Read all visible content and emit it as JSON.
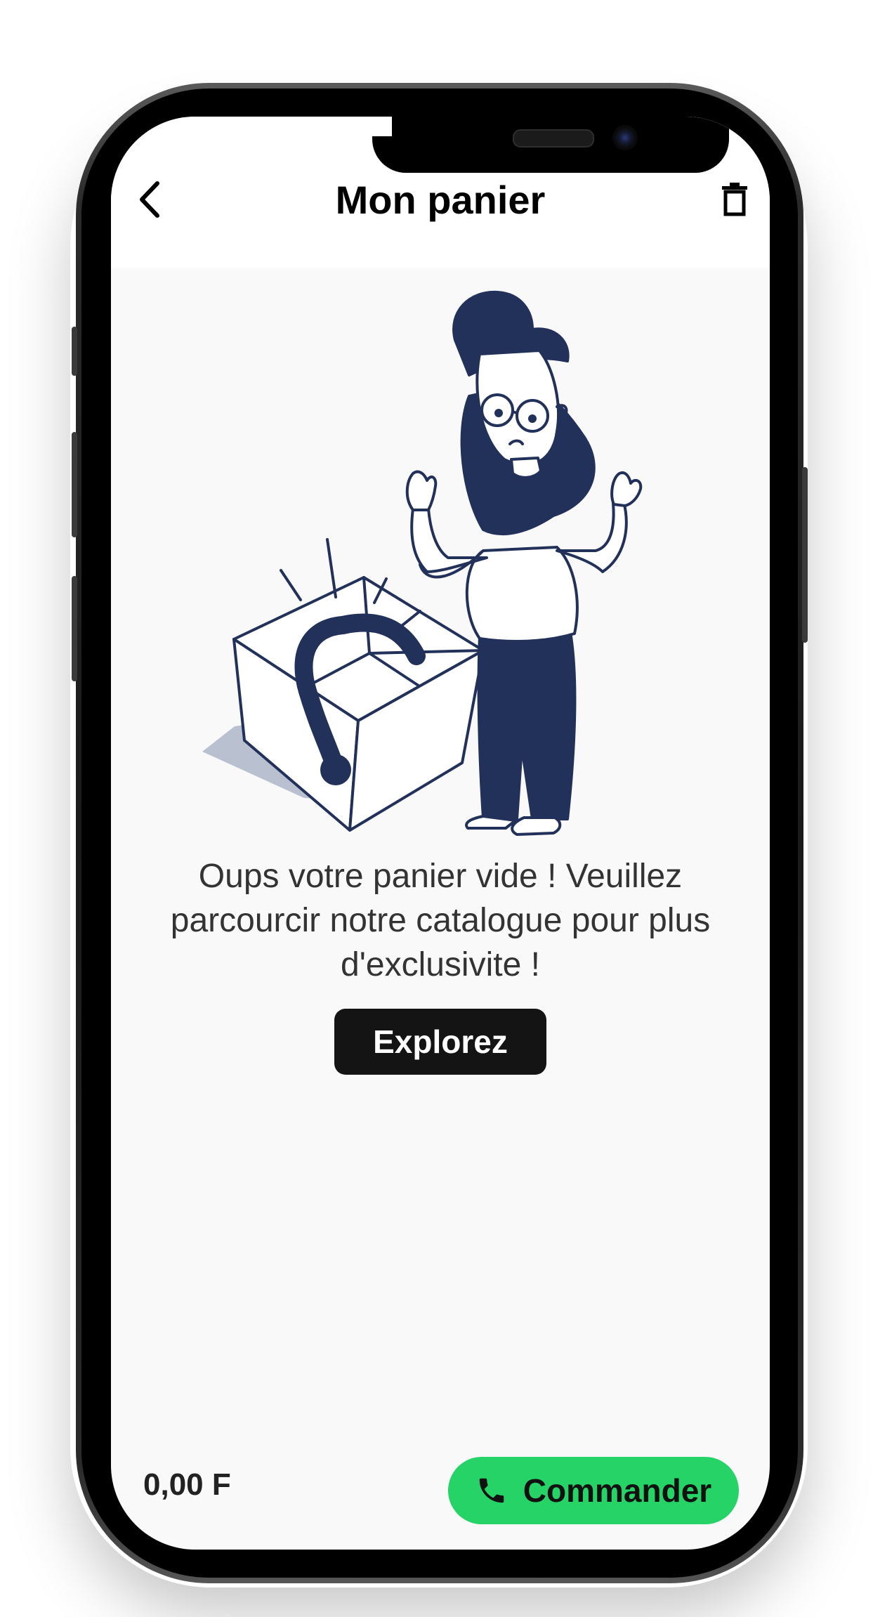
{
  "header": {
    "title": "Mon panier",
    "back_icon": "chevron-left-icon",
    "trash_icon": "trash-icon"
  },
  "empty_state": {
    "illustration": "woman-empty-basket-illustration",
    "message": "Oups votre panier vide ! Veuillez parcourcir notre catalogue pour plus d'exclusivite !",
    "explore_label": "Explorez"
  },
  "footer": {
    "total": "0,00 F",
    "order_label": "Commander",
    "order_icon": "phone-icon"
  },
  "colors": {
    "accent_green": "#25d366",
    "illustration_navy": "#22315a",
    "button_dark": "#141414",
    "screen_bg": "#faf9f9"
  }
}
